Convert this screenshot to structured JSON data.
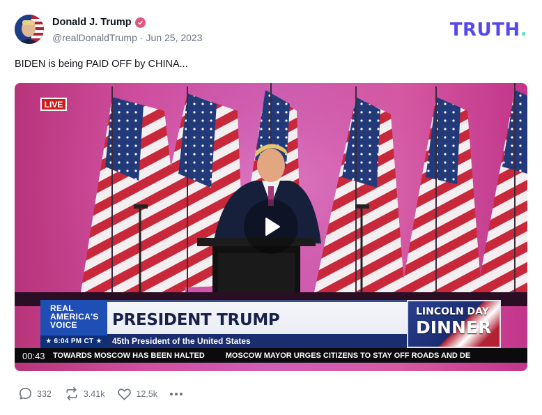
{
  "author": {
    "display_name": "Donald J. Trump",
    "handle": "@realDonaldTrump",
    "separator": "·",
    "date": "Jun 25, 2023",
    "verified_color": "#e0567c"
  },
  "brand": {
    "name": "TRUTH",
    "dot": ".",
    "color": "#5448ee",
    "dot_color": "#5fe3c5"
  },
  "post": {
    "text": "BIDEN is being PAID OFF by CHINA..."
  },
  "video": {
    "live_badge": "LIVE",
    "elapsed": "00:43",
    "lower_third": {
      "network_line1": "REAL",
      "network_line2": "AMERICA'S",
      "network_line3": "VOICE",
      "clock": "★ 6:04 PM CT ★",
      "headline": "PRESIDENT TRUMP",
      "subheadline": "45th President of the United States",
      "event_line1": "LINCOLN DAY",
      "event_line2": "DINNER"
    },
    "ticker": [
      "TOWARDS MOSCOW HAS BEEN HALTED",
      "MOSCOW MAYOR URGES CITIZENS TO STAY OFF ROADS AND DE"
    ]
  },
  "actions": {
    "replies": "332",
    "retruths": "3.41k",
    "likes": "12.5k"
  },
  "icons": [
    "reply-icon",
    "retruth-icon",
    "like-icon",
    "more-icon",
    "play-icon",
    "verified-icon"
  ]
}
